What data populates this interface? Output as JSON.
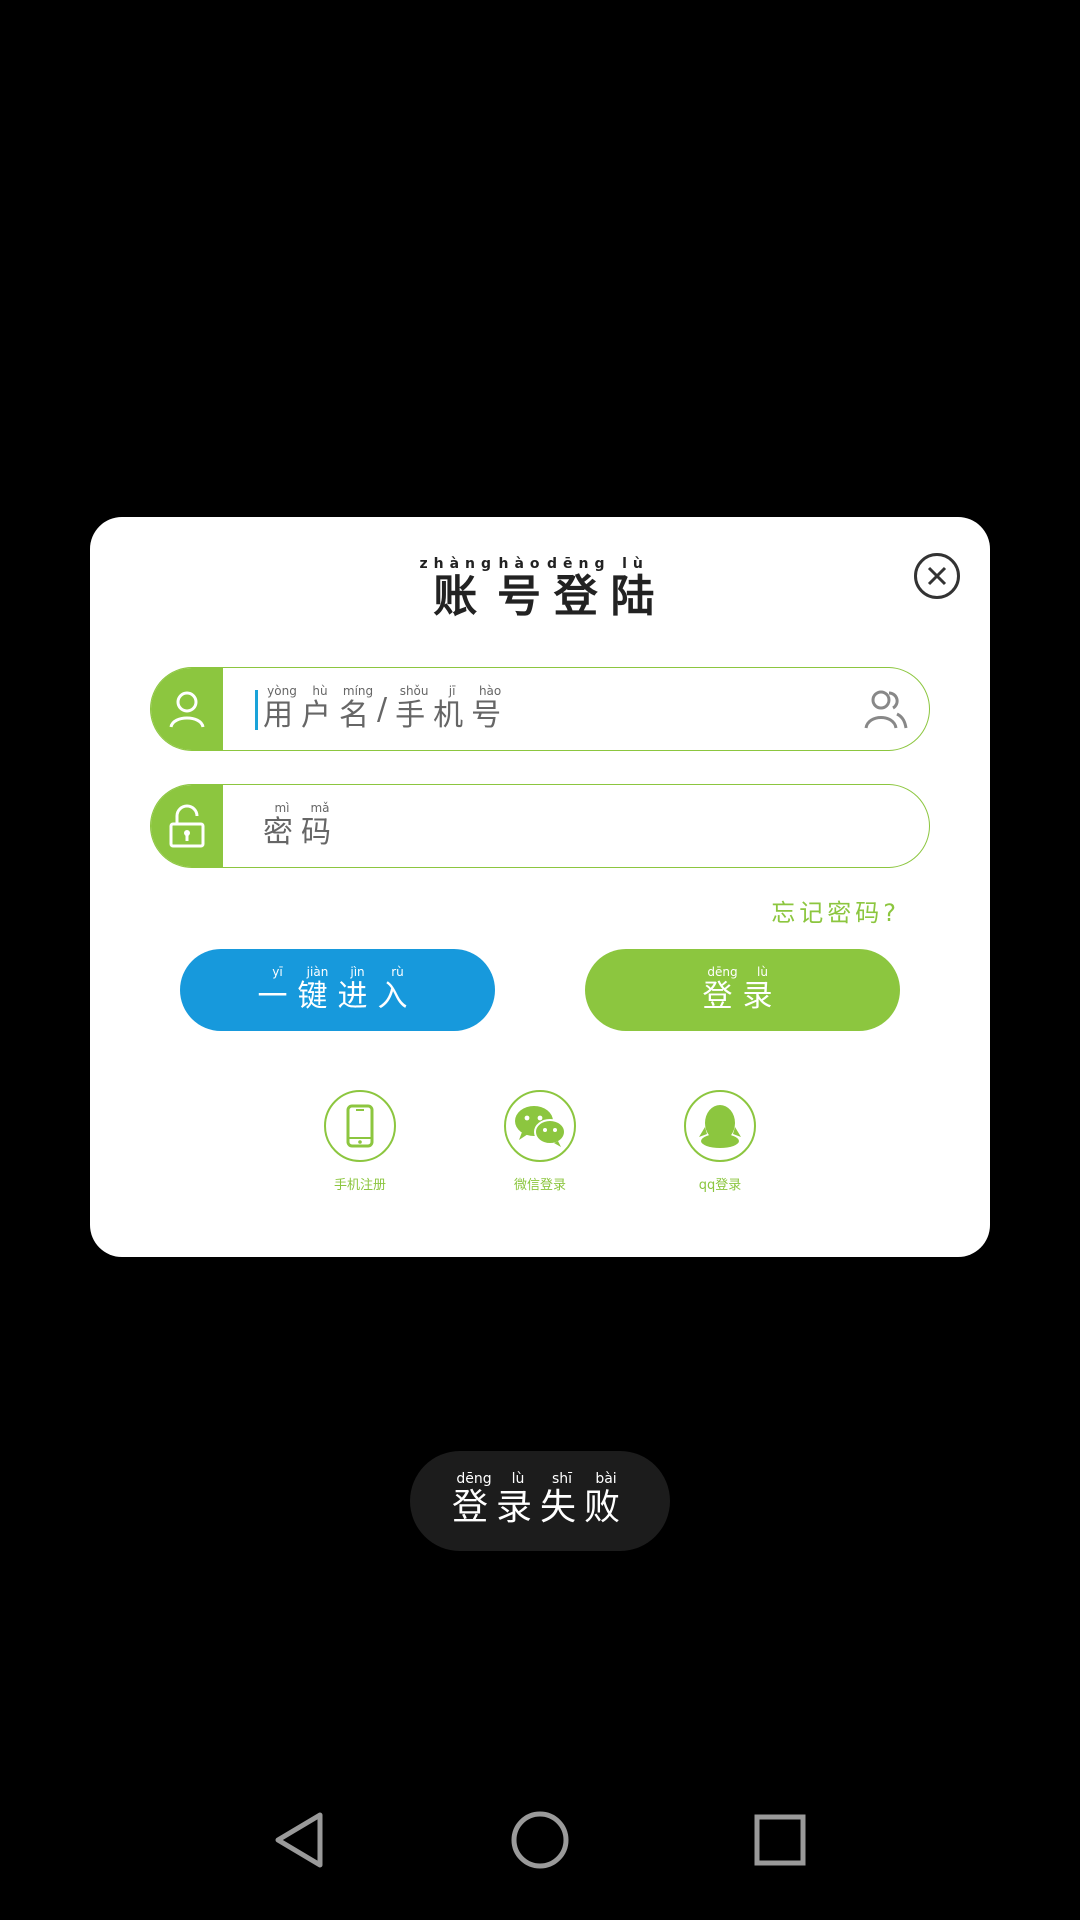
{
  "dialog": {
    "title": [
      {
        "char": "账",
        "pinyin": "zhàng"
      },
      {
        "char": "号",
        "pinyin": "hào"
      },
      {
        "char": "登",
        "pinyin": "dēng"
      },
      {
        "char": "陆",
        "pinyin": "lù"
      }
    ],
    "close_icon": "close-icon",
    "username_placeholder": [
      {
        "char": "用",
        "pinyin": "yòng"
      },
      {
        "char": "户",
        "pinyin": "hù"
      },
      {
        "char": "名",
        "pinyin": "míng"
      },
      {
        "char": "/",
        "pinyin": ""
      },
      {
        "char": "手",
        "pinyin": "shǒu"
      },
      {
        "char": "机",
        "pinyin": "jī"
      },
      {
        "char": "号",
        "pinyin": "hào"
      }
    ],
    "password_placeholder": [
      {
        "char": "密",
        "pinyin": "mì"
      },
      {
        "char": "码",
        "pinyin": "mǎ"
      }
    ],
    "forgot_password": [
      {
        "char": "忘",
        "pinyin": ""
      },
      {
        "char": "记",
        "pinyin": ""
      },
      {
        "char": "密",
        "pinyin": ""
      },
      {
        "char": "码",
        "pinyin": ""
      },
      {
        "char": "?",
        "pinyin": ""
      }
    ],
    "quick_enter_button": [
      {
        "char": "一",
        "pinyin": "yī"
      },
      {
        "char": "键",
        "pinyin": "jiàn"
      },
      {
        "char": "进",
        "pinyin": "jìn"
      },
      {
        "char": "入",
        "pinyin": "rù"
      }
    ],
    "login_button": [
      {
        "char": "登",
        "pinyin": "dēng"
      },
      {
        "char": "录",
        "pinyin": "lù"
      }
    ],
    "social": [
      {
        "icon": "phone-icon",
        "label": "手机注册"
      },
      {
        "icon": "wechat-icon",
        "label": "微信登录"
      },
      {
        "icon": "qq-icon",
        "label": "qq登录"
      }
    ]
  },
  "toast": [
    {
      "char": "登",
      "pinyin": "dēng"
    },
    {
      "char": "录",
      "pinyin": "lù"
    },
    {
      "char": "失",
      "pinyin": "shī"
    },
    {
      "char": "败",
      "pinyin": "bài"
    }
  ],
  "nav_bar": {
    "icons": [
      "back-icon",
      "home-icon",
      "recent-apps-icon"
    ]
  },
  "colors": {
    "accent_green": "#8cc63f",
    "accent_blue": "#1799dc",
    "background": "#000000",
    "dialog": "#ffffff"
  }
}
